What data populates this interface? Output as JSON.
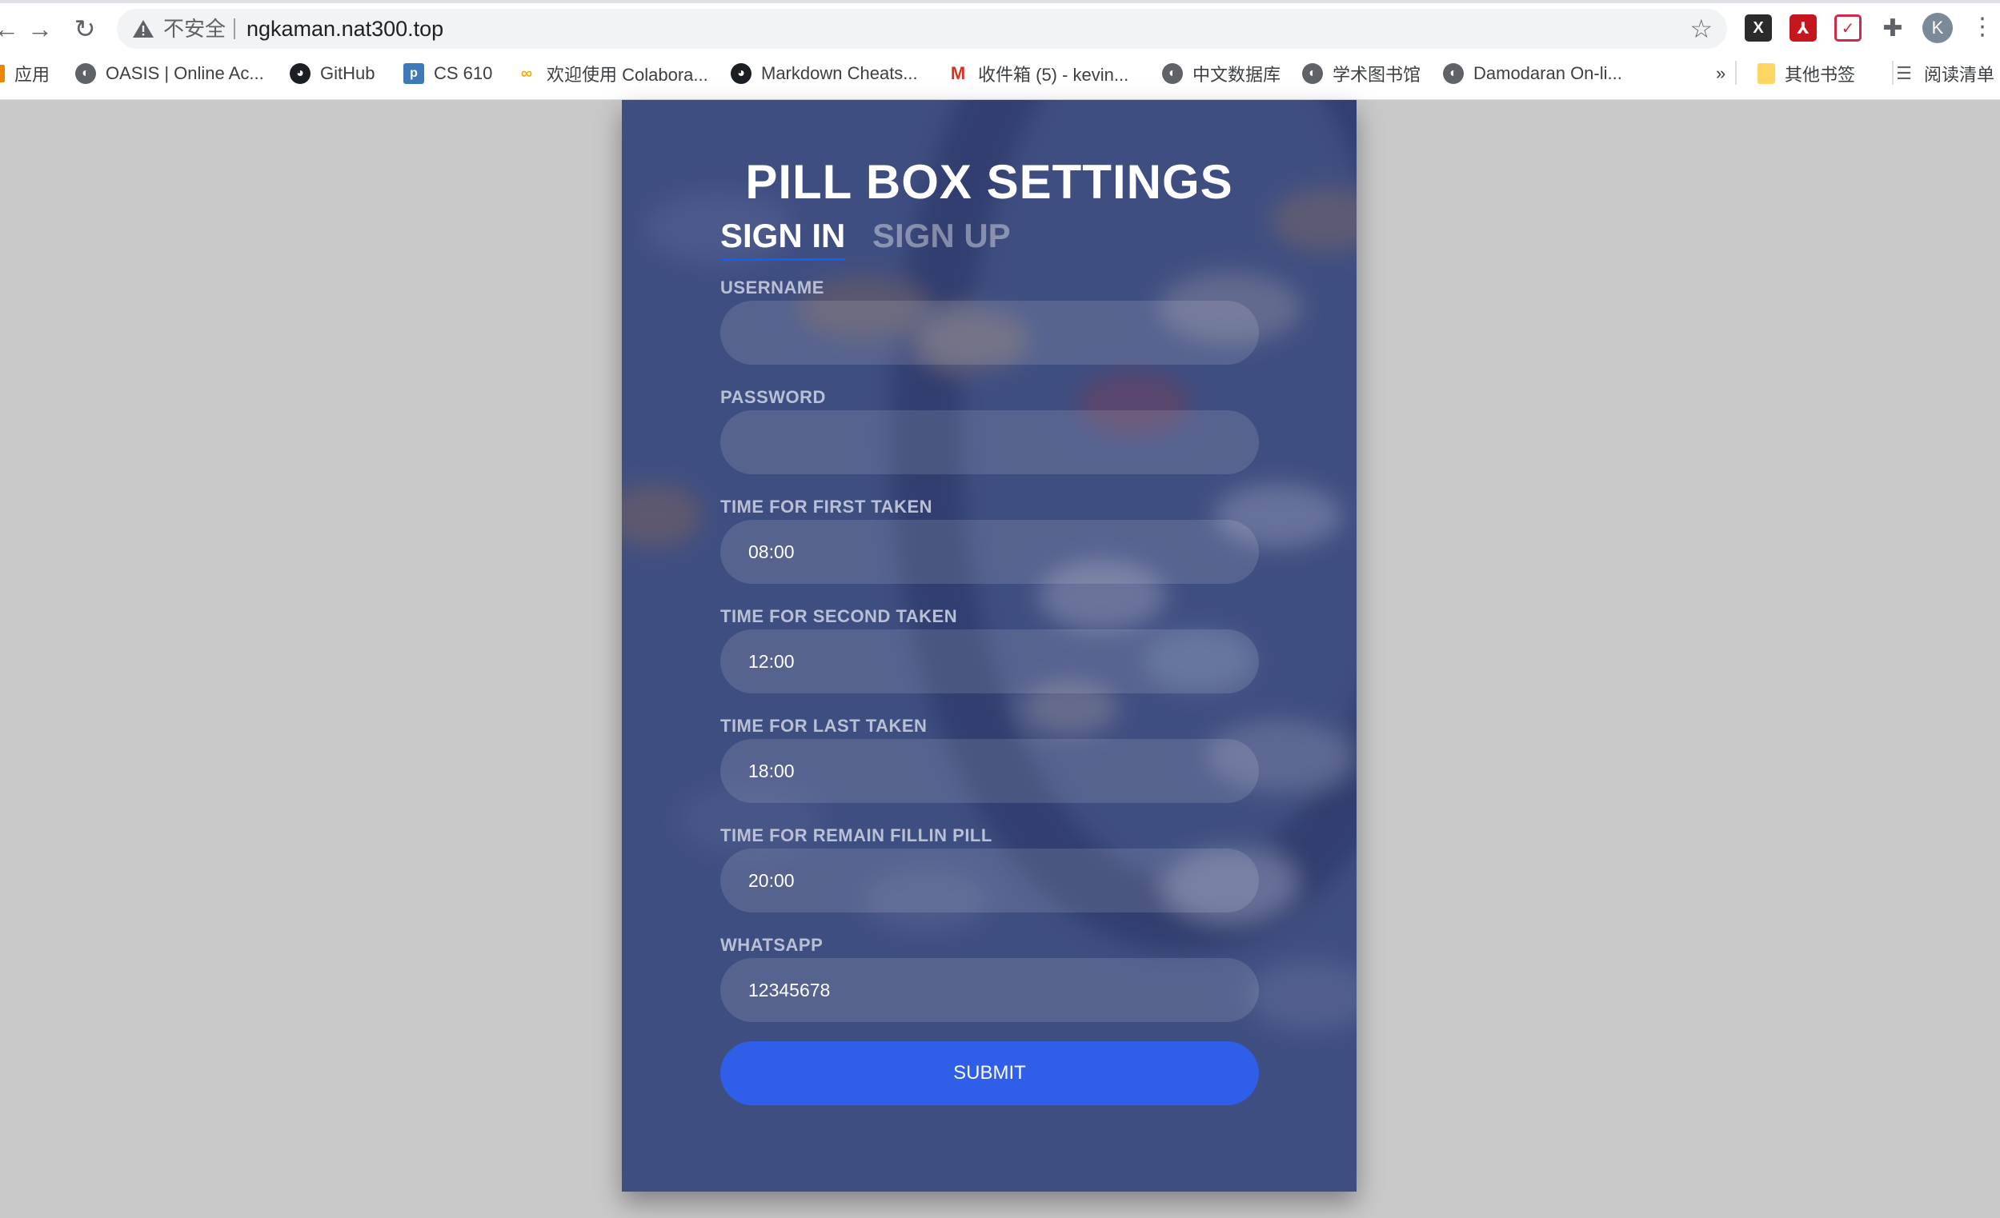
{
  "browser": {
    "insecure_label": "不安全",
    "url": "ngkaman.nat300.top",
    "avatar_letter": "K",
    "bookmarks": [
      {
        "label": "应用",
        "icon": "apps-grid-icon"
      },
      {
        "label": "OASIS | Online Ac...",
        "icon": "globe-icon"
      },
      {
        "label": "GitHub",
        "icon": "github-icon"
      },
      {
        "label": "CS 610",
        "icon": "piazza-icon"
      },
      {
        "label": "欢迎使用 Colabora...",
        "icon": "colab-icon"
      },
      {
        "label": "Markdown Cheats...",
        "icon": "github-icon"
      },
      {
        "label": "收件箱 (5) - kevin...",
        "icon": "gmail-icon"
      },
      {
        "label": "中文数据库",
        "icon": "globe-icon"
      },
      {
        "label": "学术图书馆",
        "icon": "globe-icon"
      },
      {
        "label": "Damodaran On-li...",
        "icon": "globe-icon"
      }
    ],
    "overflow_label": "»",
    "other_bookmarks": "其他书签",
    "reading_list": "阅读清单"
  },
  "form": {
    "title": "PILL BOX SETTINGS",
    "tabs": [
      {
        "label": "SIGN IN",
        "active": true
      },
      {
        "label": "SIGN UP",
        "active": false
      }
    ],
    "fields": [
      {
        "label": "USERNAME",
        "value": ""
      },
      {
        "label": "PASSWORD",
        "value": ""
      },
      {
        "label": "TIME FOR FIRST TAKEN",
        "value": "08:00"
      },
      {
        "label": "TIME FOR SECOND TAKEN",
        "value": "12:00"
      },
      {
        "label": "TIME FOR LAST TAKEN",
        "value": "18:00"
      },
      {
        "label": "TIME FOR REMAIN FILLIN PILL",
        "value": "20:00"
      },
      {
        "label": "WHATSAPP",
        "value": "12345678"
      }
    ],
    "submit_label": "SUBMIT"
  },
  "colors": {
    "page_bg": "#c9c9c9",
    "card_bg": "#3e4c7c",
    "accent": "#2f5ee8",
    "tab_underline": "#1161ee"
  }
}
